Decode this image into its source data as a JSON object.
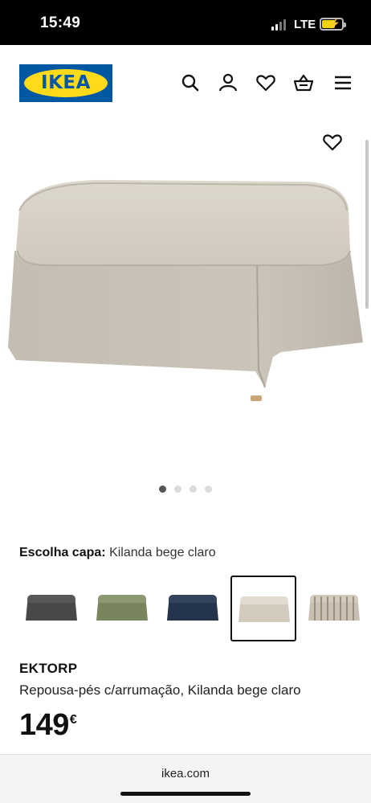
{
  "status": {
    "time": "15:49",
    "network": "LTE"
  },
  "header": {
    "logo_text": "IKEA",
    "icons": [
      "search-icon",
      "account-icon",
      "heart-icon",
      "basket-icon",
      "menu-icon"
    ]
  },
  "gallery": {
    "image_count": 4,
    "active_index": 0
  },
  "cover": {
    "label": "Escolha capa:",
    "value": "Kilanda bege claro"
  },
  "swatches": [
    {
      "name": "dark grey",
      "color": "#4b4b4d"
    },
    {
      "name": "green",
      "color": "#7d8a62"
    },
    {
      "name": "dark blue",
      "color": "#27374f"
    },
    {
      "name": "light beige",
      "color": "#d8d0c4",
      "selected": true
    },
    {
      "name": "striped beige",
      "color": "#c9bfb3"
    }
  ],
  "product": {
    "name": "EKTORP",
    "description": "Repousa-pés c/arrumação, Kilanda bege claro",
    "price": "149",
    "currency": "€"
  },
  "browser": {
    "url": "ikea.com"
  },
  "colors": {
    "ikea_blue": "#0058a3",
    "ikea_yellow": "#ffda1a"
  }
}
